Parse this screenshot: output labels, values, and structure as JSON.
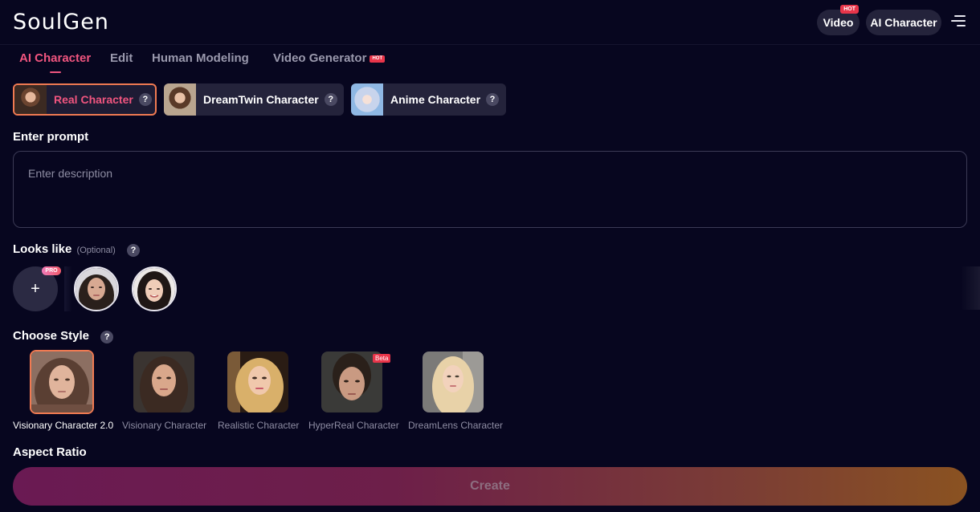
{
  "header": {
    "logo": "SoulGen",
    "video_label": "Video",
    "video_badge": "HOT",
    "ai_character_label": "AI Character",
    "menu_icon": "hamburger-menu-icon"
  },
  "tabs": [
    {
      "label": "AI Character",
      "active": true
    },
    {
      "label": "Edit",
      "active": false
    },
    {
      "label": "Human Modeling",
      "active": false
    },
    {
      "label": "Video Generator",
      "active": false,
      "badge": "HOT"
    }
  ],
  "character_types": [
    {
      "label": "Real Character",
      "active": true
    },
    {
      "label": "DreamTwin Character",
      "active": false
    },
    {
      "label": "Anime Character",
      "active": false
    }
  ],
  "help_glyph": "?",
  "prompt": {
    "label": "Enter prompt",
    "placeholder": "Enter description",
    "value": ""
  },
  "looks_like": {
    "label": "Looks like",
    "optional": "(Optional)",
    "add_glyph": "+",
    "pro_badge": "PRO"
  },
  "choose_style": {
    "label": "Choose Style",
    "styles": [
      {
        "name": "Visionary Character 2.0",
        "active": true
      },
      {
        "name": "Visionary Character",
        "active": false
      },
      {
        "name": "Realistic Character",
        "active": false
      },
      {
        "name": "HyperReal Character",
        "active": false,
        "badge": "Beta"
      },
      {
        "name": "DreamLens Character",
        "active": false
      }
    ]
  },
  "aspect_ratio": {
    "label": "Aspect Ratio"
  },
  "create": {
    "label": "Create"
  },
  "colors": {
    "background": "#07061f",
    "accent_pink": "#f0557f",
    "accent_orange": "#f07a52",
    "card": "#24233b",
    "hot_badge": "#e8354a"
  }
}
